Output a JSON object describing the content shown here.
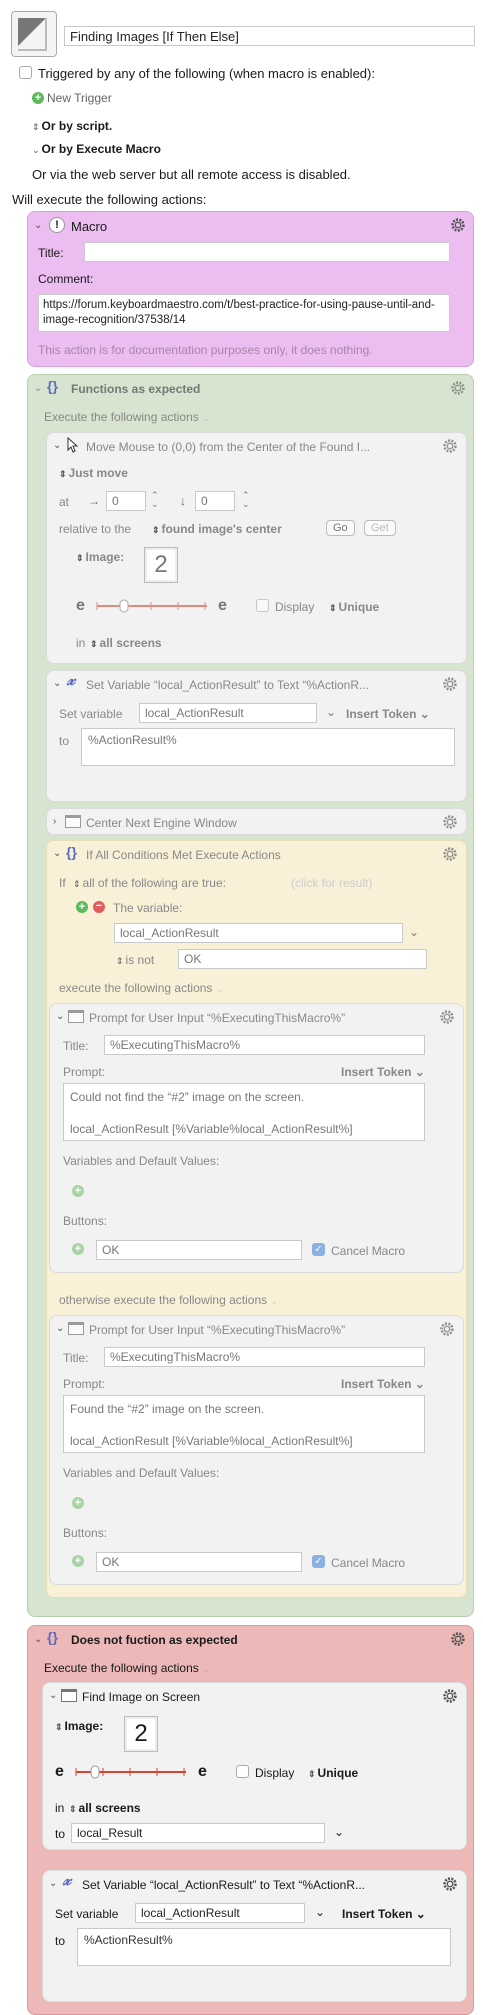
{
  "macro": {
    "name": "Finding Images [If Then Else]"
  },
  "triggers": {
    "triggered_label": "Triggered by any of the following (when macro is enabled):",
    "new_trigger": "New Trigger",
    "or_by_script": "Or by script.",
    "or_by_execute": "Or by Execute Macro",
    "web_server": "Or via the web server but all remote access is disabled.",
    "will_execute": "Will execute the following actions:"
  },
  "action_macro": {
    "header": "Macro",
    "title_label": "Title:",
    "title_value": "",
    "comment_label": "Comment:",
    "comment_value": "https://forum.keyboardmaestro.com/t/best-practice-for-using-pause-until-and-image-recognition/37538/14",
    "doc_note": "This action is for documentation purposes only, it does nothing."
  },
  "group1": {
    "header": "Functions as expected",
    "execute_label": "Execute the following actions",
    "move_mouse": {
      "header": "Move Mouse to (0,0) from the Center of the Found I...",
      "just_move": "Just move",
      "at_label": "at",
      "x_value": "0",
      "y_value": "0",
      "relative_label": "relative to the",
      "relative_value": "found image's center",
      "go": "Go",
      "get": "Get",
      "image_label": "Image:",
      "image_value": "2",
      "display": "Display",
      "unique": "Unique",
      "in_label": "in",
      "screens": "all screens",
      "fuzz_left": "e",
      "fuzz_right": "e"
    },
    "set_var": {
      "header": "Set Variable “local_ActionResult” to Text “%ActionR...",
      "set_label": "Set variable",
      "var_value": "local_ActionResult",
      "insert_token": "Insert Token",
      "to_label": "to",
      "to_value": "%ActionResult%"
    },
    "center_next": {
      "header": "Center Next Engine Window"
    },
    "if_all": {
      "header": "If All Conditions Met Execute Actions",
      "if_label": "If",
      "all_of": "all of the following are true:",
      "click_result": "(click for result)",
      "the_variable": "The variable:",
      "var_value": "local_ActionResult",
      "is_not": "is not",
      "is_not_value": "OK",
      "execute_label": "execute the following actions",
      "otherwise_label": "otherwise execute the following actions",
      "prompt1": {
        "header": "Prompt for User Input “%ExecutingThisMacro%”",
        "title_label": "Title:",
        "title_value": "%ExecutingThisMacro%",
        "prompt_label": "Prompt:",
        "insert_token": "Insert Token",
        "prompt_value": "Could not find the “#2” image on the screen.\n\nlocal_ActionResult [%Variable%local_ActionResult%]",
        "vars_label": "Variables and Default Values:",
        "buttons_label": "Buttons:",
        "button_value": "OK",
        "cancel_macro": "Cancel Macro"
      },
      "prompt2": {
        "header": "Prompt for User Input “%ExecutingThisMacro%”",
        "title_label": "Title:",
        "title_value": "%ExecutingThisMacro%",
        "prompt_label": "Prompt:",
        "insert_token": "Insert Token",
        "prompt_value": "Found the “#2” image on the screen.\n\nlocal_ActionResult [%Variable%local_ActionResult%]",
        "vars_label": "Variables and Default Values:",
        "buttons_label": "Buttons:",
        "button_value": "OK",
        "cancel_macro": "Cancel Macro"
      }
    }
  },
  "group2": {
    "header": "Does not fuction as expected",
    "execute_label": "Execute the following actions",
    "find_image": {
      "header": "Find Image on Screen",
      "image_label": "Image:",
      "image_value": "2",
      "display": "Display",
      "unique": "Unique",
      "in_label": "in",
      "screens": "all screens",
      "to_label": "to",
      "to_value": "local_Result",
      "fuzz_left": "e",
      "fuzz_right": "e"
    },
    "set_var": {
      "header": "Set Variable “local_ActionResult” to Text “%ActionR...",
      "set_label": "Set variable",
      "var_value": "local_ActionResult",
      "insert_token": "Insert Token",
      "to_label": "to",
      "to_value": "%ActionResult%"
    }
  },
  "colors": {
    "macro_bg": "#ebbdf0",
    "group1_bg": "#d7e4cf",
    "group2_bg": "#edb8b8",
    "if_bg": "#f8f1d8",
    "action_bg": "#f2f2f2"
  }
}
